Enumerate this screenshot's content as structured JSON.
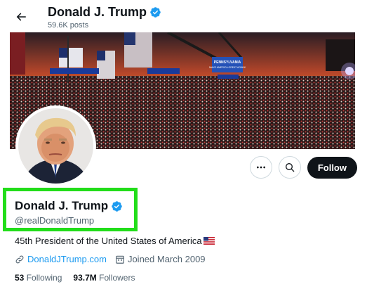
{
  "header": {
    "name": "Donald J. Trump",
    "posts": "59.6K posts"
  },
  "banner": {
    "signs": [
      "PENNSYLVANIA",
      "MAKE AMERICA GREAT AGAIN!"
    ]
  },
  "profile": {
    "name": "Donald J. Trump",
    "handle": "@realDonaldTrump",
    "bio": "45th President of the United States of America",
    "website": "DonaldJTrump.com",
    "joined": "Joined March 2009",
    "following_count": "53",
    "following_label": "Following",
    "followers_count": "93.7M",
    "followers_label": "Followers"
  },
  "actions": {
    "follow_label": "Follow"
  },
  "colors": {
    "accent": "#1d9bf0",
    "verified": "#1d9bf0",
    "highlight": "#22dd1a",
    "follow_bg": "#0f1419"
  },
  "icons": [
    "back-arrow-icon",
    "verified-badge-icon",
    "more-icon",
    "search-icon",
    "link-icon",
    "calendar-icon",
    "us-flag-icon"
  ]
}
